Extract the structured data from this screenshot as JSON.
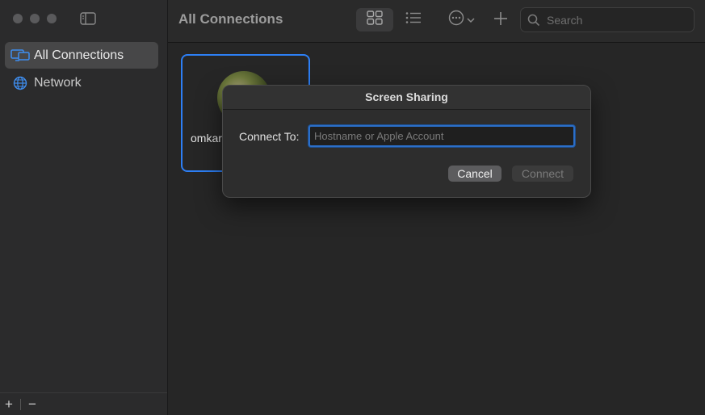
{
  "sidebar": {
    "items": [
      {
        "label": "All Connections",
        "icon": "display-icon",
        "active": true
      },
      {
        "label": "Network",
        "icon": "globe-icon",
        "active": false
      }
    ],
    "footer": {
      "add_label": "+",
      "remove_label": "−"
    }
  },
  "toolbar": {
    "title": "All Connections",
    "search_placeholder": "Search"
  },
  "connections": [
    {
      "name": "omkar"
    }
  ],
  "dialog": {
    "title": "Screen Sharing",
    "connect_to_label": "Connect To:",
    "field_placeholder": "Hostname or Apple Account",
    "field_value": "",
    "cancel_label": "Cancel",
    "connect_label": "Connect"
  },
  "colors": {
    "accent": "#2d7ff5",
    "sidebar_icon": "#3f8ef0"
  }
}
